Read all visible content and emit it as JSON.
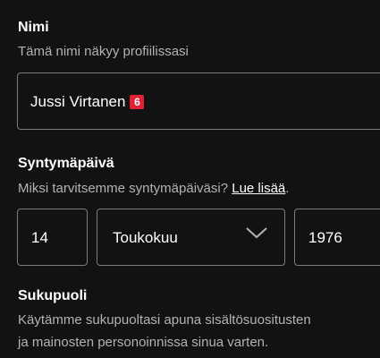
{
  "name_section": {
    "label": "Nimi",
    "hint": "Tämä nimi näkyy profiilissasi",
    "value": "Jussi Virtanen",
    "badge": "6"
  },
  "birthday_section": {
    "label": "Syntymäpäivä",
    "hint_prefix": "Miksi tarvitsemme syntymäpäiväsi? ",
    "learn_more": "Lue lisää",
    "hint_suffix": ".",
    "day": "14",
    "month": "Toukokuu",
    "year": "1976"
  },
  "gender_section": {
    "label": "Sukupuoli",
    "description_line1": "Käytämme sukupuoltasi apuna sisältösuositusten",
    "description_line2": "ja mainosten personoinnissa sinua varten."
  },
  "colors": {
    "background": "#121212",
    "border": "#7c7c7c",
    "muted_text": "#b3b3b3",
    "badge": "#e22134"
  },
  "icons": {
    "month_dropdown": "chevron-down-icon"
  }
}
